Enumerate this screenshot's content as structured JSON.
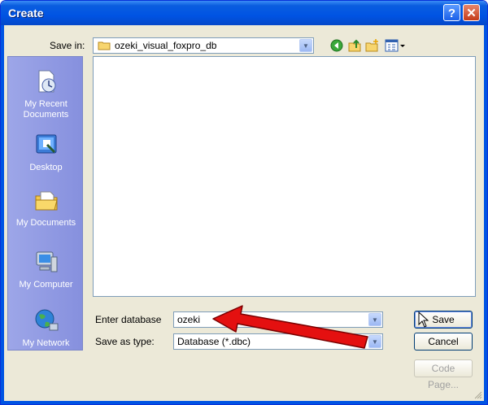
{
  "window": {
    "title": "Create"
  },
  "save_in": {
    "label": "Save in:",
    "value": "ozeki_visual_foxpro_db"
  },
  "places": [
    {
      "label": "My Recent Documents"
    },
    {
      "label": "Desktop"
    },
    {
      "label": "My Documents"
    },
    {
      "label": "My Computer"
    },
    {
      "label": "My Network"
    }
  ],
  "database": {
    "label": "Enter database",
    "value": "ozeki"
  },
  "save_as_type": {
    "label": "Save as type:",
    "value": "Database (*.dbc)"
  },
  "buttons": {
    "save": "Save",
    "cancel": "Cancel",
    "code_page": "Code Page..."
  },
  "colors": {
    "title_bar": "#0054e3",
    "places_bar": "#8c9ae6",
    "arrow": "#e41010"
  }
}
